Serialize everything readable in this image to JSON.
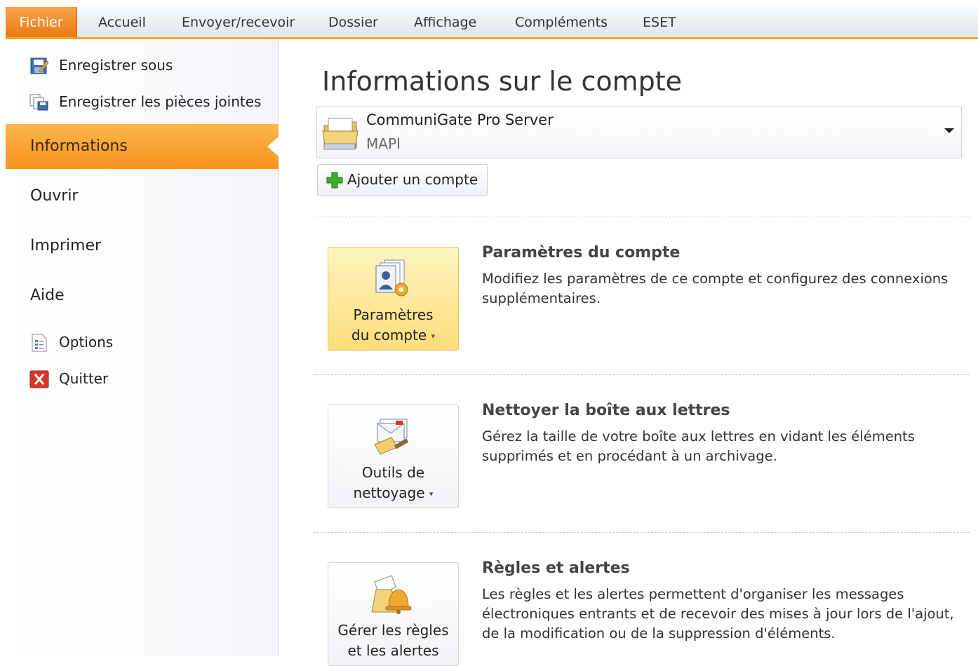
{
  "ribbon": {
    "tabs": [
      "Fichier",
      "Accueil",
      "Envoyer/recevoir",
      "Dossier",
      "Affichage",
      "Compléments",
      "ESET"
    ]
  },
  "backstage": {
    "commands_top": [
      {
        "label": "Enregistrer sous",
        "icon": "save-as-icon"
      },
      {
        "label": "Enregistrer les pièces jointes",
        "icon": "save-attachments-icon"
      }
    ],
    "nav": [
      {
        "label": "Informations",
        "active": true
      },
      {
        "label": "Ouvrir",
        "active": false
      },
      {
        "label": "Imprimer",
        "active": false
      },
      {
        "label": "Aide",
        "active": false
      }
    ],
    "commands_bottom": [
      {
        "label": "Options",
        "icon": "options-icon"
      },
      {
        "label": "Quitter",
        "icon": "exit-icon"
      }
    ]
  },
  "main": {
    "title": "Informations sur le compte",
    "account": {
      "name": "CommuniGate Pro Server",
      "type": "MAPI"
    },
    "add_account_label": "Ajouter un compte",
    "sections": [
      {
        "button_line1": "Paramètres",
        "button_line2": "du compte",
        "title": "Paramètres du compte",
        "description": "Modifiez les paramètres de ce compte et configurez des connexions supplémentaires.",
        "icon": "account-settings-icon",
        "highlighted": true
      },
      {
        "button_line1": "Outils de",
        "button_line2": "nettoyage",
        "title": "Nettoyer la boîte aux lettres",
        "description": "Gérez la taille de votre boîte aux lettres en vidant les éléments supprimés et en procédant à un archivage.",
        "icon": "cleanup-tools-icon",
        "highlighted": false
      },
      {
        "button_line1": "Gérer les règles",
        "button_line2": "et les alertes",
        "title": "Règles et alertes",
        "description": "Les règles et les alertes permettent d'organiser les messages électroniques entrants et de recevoir des mises à jour lors de l'ajout, de la modification ou de la suppression d'éléments.",
        "icon": "rules-alerts-icon",
        "highlighted": false
      }
    ]
  },
  "colors": {
    "accent": "#f6941e",
    "file_tab": "#ea7a13",
    "highlight": "#fddd7a"
  }
}
